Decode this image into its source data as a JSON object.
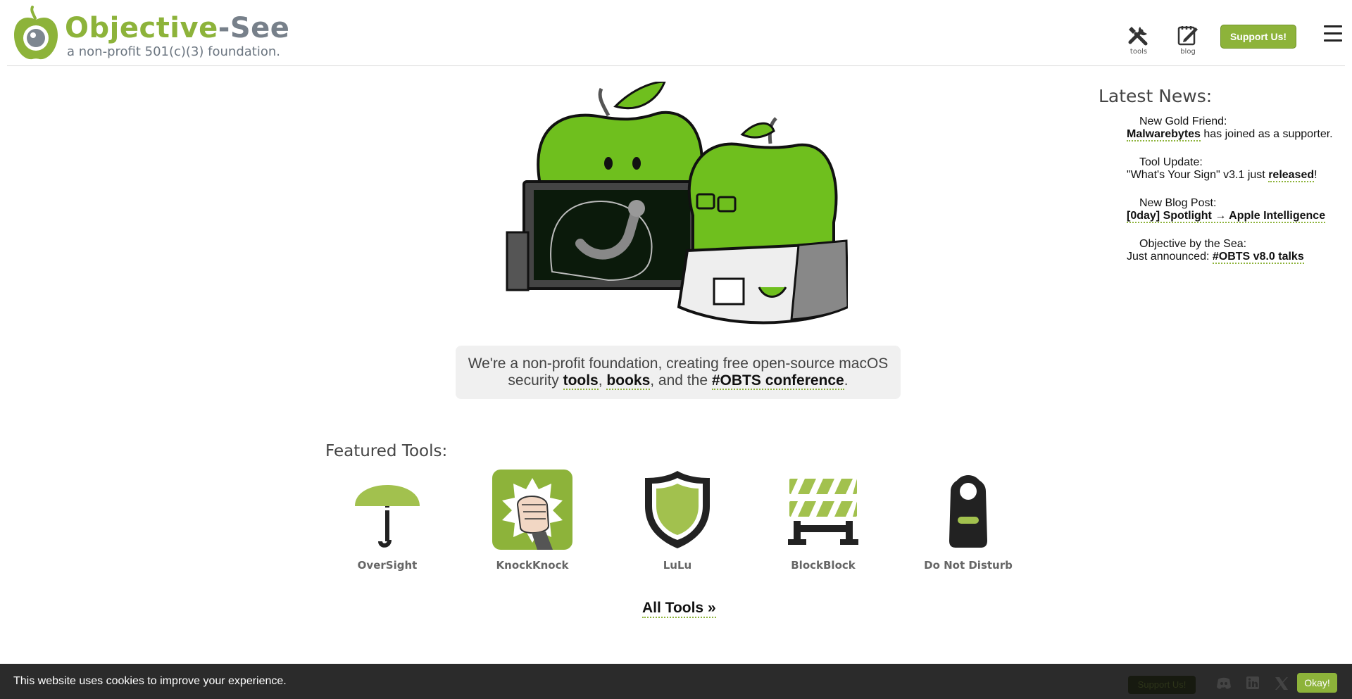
{
  "header": {
    "brand_part1": "Objective",
    "brand_part2": "-See",
    "tagline": "a non-profit 501(c)(3) foundation.",
    "nav": [
      {
        "label": "tools",
        "icon": "tools-icon"
      },
      {
        "label": "blog",
        "icon": "blog-icon"
      }
    ],
    "support_label": "Support Us!"
  },
  "intro": {
    "line1": "We're a non-profit foundation, creating free open-source macOS",
    "line2_prefix": "security ",
    "link_tools": "tools",
    "sep1": ", ",
    "link_books": "books",
    "sep2": ", and the ",
    "link_conf": "#OBTS conference",
    "end": "."
  },
  "news": {
    "title": "Latest News:",
    "items": [
      {
        "icon": "",
        "heading": "New Gold Friend:",
        "link": "Malwarebytes",
        "pre": "",
        "post": " has joined as a supporter."
      },
      {
        "icon": "",
        "heading": "Tool Update:",
        "pre": "\"What's Your Sign\" v3.1 just ",
        "link": "released",
        "post": "!"
      },
      {
        "icon": "",
        "heading": "New Blog Post:",
        "pre": "",
        "link": "[0day] Spotlight → Apple Intelligence",
        "post": ""
      },
      {
        "icon": "",
        "heading": "Objective by the Sea:",
        "pre": "Just announced: ",
        "link": "#OBTS v8.0 talks",
        "post": ""
      }
    ]
  },
  "featured": {
    "title": "Featured Tools:",
    "tools": [
      {
        "name": "OverSight",
        "icon": "umbrella-icon"
      },
      {
        "name": "KnockKnock",
        "icon": "fist-icon"
      },
      {
        "name": "LuLu",
        "icon": "shield-icon"
      },
      {
        "name": "BlockBlock",
        "icon": "barrier-icon"
      },
      {
        "name": "Do Not Disturb",
        "icon": "door-hanger-icon"
      }
    ],
    "all_tools": "All Tools »"
  },
  "cookie": {
    "text": "This website uses cookies to improve your experience.",
    "okay": "Okay!",
    "support_label": "Support Us!"
  },
  "colors": {
    "accent": "#8db33a",
    "brand_gray": "#77808a",
    "cookie_bg": "#2b2b2b"
  }
}
